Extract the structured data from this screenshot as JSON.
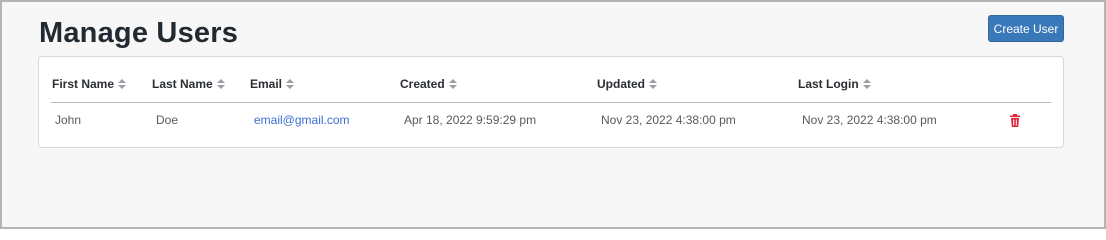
{
  "header": {
    "title": "Manage Users",
    "create_button_label": "Create User"
  },
  "table": {
    "columns": [
      {
        "label": "First Name"
      },
      {
        "label": "Last Name"
      },
      {
        "label": "Email"
      },
      {
        "label": "Created"
      },
      {
        "label": "Updated"
      },
      {
        "label": "Last Login"
      }
    ],
    "rows": [
      {
        "first_name": "John",
        "last_name": "Doe",
        "email": "email@gmail.com",
        "created": "Apr 18, 2022 9:59:29 pm",
        "updated": "Nov 23, 2022 4:38:00 pm",
        "last_login": "Nov 23, 2022 4:38:00 pm",
        "delete_icon": "trash-icon"
      }
    ]
  },
  "colors": {
    "accent": "#3a79b9",
    "link": "#3b6fd1",
    "danger": "#e0243c"
  }
}
